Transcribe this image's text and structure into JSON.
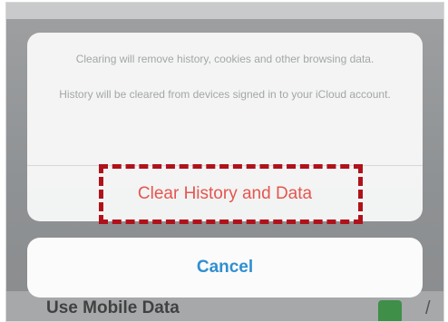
{
  "action_sheet": {
    "message_line_1": "Clearing will remove history, cookies and other browsing data.",
    "message_line_2": "History will be cleared from devices signed in to your iCloud account.",
    "destructive_button_label": "Clear History and Data",
    "cancel_button_label": "Cancel"
  },
  "background": {
    "partial_row_label": "Use Mobile Data"
  },
  "colors": {
    "destructive": "#e5554f",
    "cancel": "#2f8fd0",
    "highlight_annotation": "#b0121b",
    "message_text": "#a4a6a8"
  }
}
